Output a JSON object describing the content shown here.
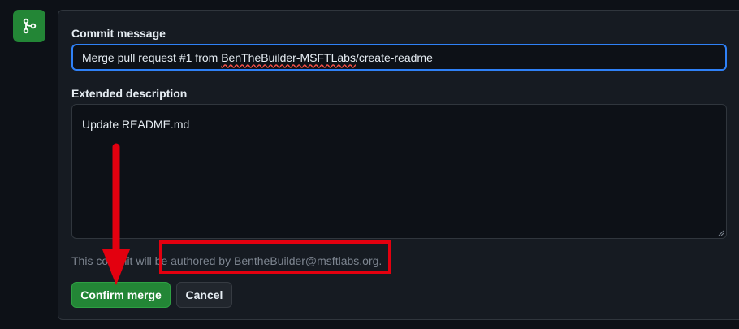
{
  "merge_icon": "git-merge-icon",
  "commit": {
    "label": "Commit message",
    "value_prefix": "Merge pull request #1 from ",
    "value_misspelled": "BenTheBuilder-MSFTLabs",
    "value_suffix": "/create-readme"
  },
  "extended": {
    "label": "Extended description",
    "value": "Update README.md"
  },
  "note": {
    "prefix": "This commit will be ",
    "highlighted": "authored by BentheBuilder@msftlabs.org."
  },
  "buttons": {
    "confirm": "Confirm merge",
    "cancel": "Cancel"
  },
  "colors": {
    "accent_green": "#238636",
    "focus_blue": "#2f81f7",
    "annotation_red": "#e3000f"
  }
}
